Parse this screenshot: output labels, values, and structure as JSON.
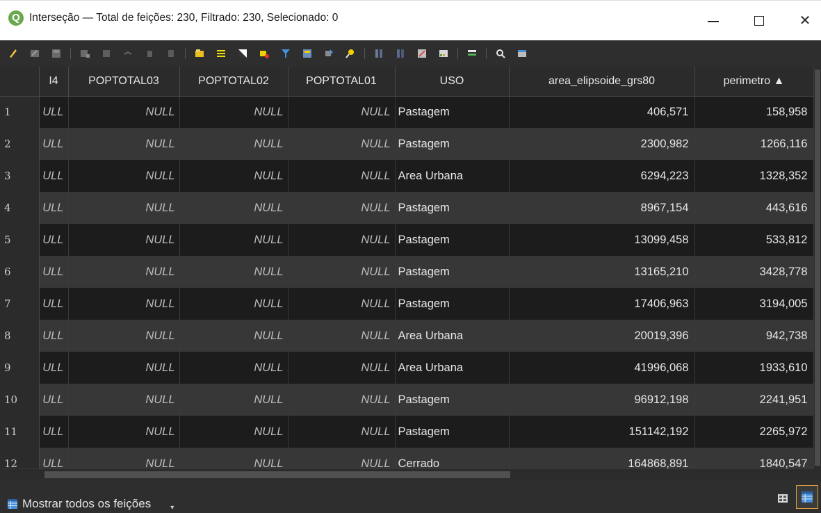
{
  "window": {
    "title": "Interseção — Total de feições: 230, Filtrado: 230, Selecionado: 0",
    "minimize_label": "",
    "maximize_label": "",
    "close_label": "✕"
  },
  "colors": {
    "qgis_green": "#6aa84f",
    "toolbar_bg": "#2e2e2e",
    "row_dark": "#1c1c1c",
    "row_light": "#373737",
    "active_view_border": "#e0a040"
  },
  "toolbar": {
    "icons": [
      "pencil-icon",
      "toggle-multi-edit-icon",
      "save-edits-icon",
      "reload-icon",
      "add-feature-icon",
      "paste-feature-icon",
      "delete-feature-icon",
      "cut-icon",
      "copy-icon",
      "paste-icon",
      "expression-select-icon",
      "select-all-icon",
      "invert-selection-icon",
      "deselect-all-icon",
      "filter-icon",
      "move-selection-top-icon",
      "pan-to-selection-icon",
      "zoom-to-selection-icon",
      "new-field-icon",
      "delete-field-icon",
      "field-calculator-icon",
      "conditional-formatting-icon",
      "dock-table-icon",
      "actions-icon",
      "organize-columns-icon"
    ]
  },
  "table": {
    "columns": [
      "I4",
      "POPTOTAL03",
      "POPTOTAL02",
      "POPTOTAL01",
      "USO",
      "area_elipsoide_grs80",
      "perimetro ▲"
    ],
    "rows": [
      {
        "n": "1",
        "c1": "ULL",
        "c2": "NULL",
        "c3": "NULL",
        "c4": "NULL",
        "uso": "Pastagem",
        "area": "406,571",
        "perim": "158,958"
      },
      {
        "n": "2",
        "c1": "ULL",
        "c2": "NULL",
        "c3": "NULL",
        "c4": "NULL",
        "uso": "Pastagem",
        "area": "2300,982",
        "perim": "1266,116"
      },
      {
        "n": "3",
        "c1": "ULL",
        "c2": "NULL",
        "c3": "NULL",
        "c4": "NULL",
        "uso": "Area Urbana",
        "area": "6294,223",
        "perim": "1328,352"
      },
      {
        "n": "4",
        "c1": "ULL",
        "c2": "NULL",
        "c3": "NULL",
        "c4": "NULL",
        "uso": "Pastagem",
        "area": "8967,154",
        "perim": "443,616"
      },
      {
        "n": "5",
        "c1": "ULL",
        "c2": "NULL",
        "c3": "NULL",
        "c4": "NULL",
        "uso": "Pastagem",
        "area": "13099,458",
        "perim": "533,812"
      },
      {
        "n": "6",
        "c1": "ULL",
        "c2": "NULL",
        "c3": "NULL",
        "c4": "NULL",
        "uso": "Pastagem",
        "area": "13165,210",
        "perim": "3428,778"
      },
      {
        "n": "7",
        "c1": "ULL",
        "c2": "NULL",
        "c3": "NULL",
        "c4": "NULL",
        "uso": "Pastagem",
        "area": "17406,963",
        "perim": "3194,005"
      },
      {
        "n": "8",
        "c1": "ULL",
        "c2": "NULL",
        "c3": "NULL",
        "c4": "NULL",
        "uso": "Area Urbana",
        "area": "20019,396",
        "perim": "942,738"
      },
      {
        "n": "9",
        "c1": "ULL",
        "c2": "NULL",
        "c3": "NULL",
        "c4": "NULL",
        "uso": "Area Urbana",
        "area": "41996,068",
        "perim": "1933,610"
      },
      {
        "n": "10",
        "c1": "ULL",
        "c2": "NULL",
        "c3": "NULL",
        "c4": "NULL",
        "uso": "Pastagem",
        "area": "96912,198",
        "perim": "2241,951"
      },
      {
        "n": "11",
        "c1": "ULL",
        "c2": "NULL",
        "c3": "NULL",
        "c4": "NULL",
        "uso": "Pastagem",
        "area": "151142,192",
        "perim": "2265,972"
      },
      {
        "n": "12",
        "c1": "ULL",
        "c2": "NULL",
        "c3": "NULL",
        "c4": "NULL",
        "uso": "Cerrado",
        "area": "164868,891",
        "perim": "1840,547"
      }
    ]
  },
  "footer": {
    "filter_label": "Mostrar todos os feições",
    "filter_arrow": "▾"
  }
}
